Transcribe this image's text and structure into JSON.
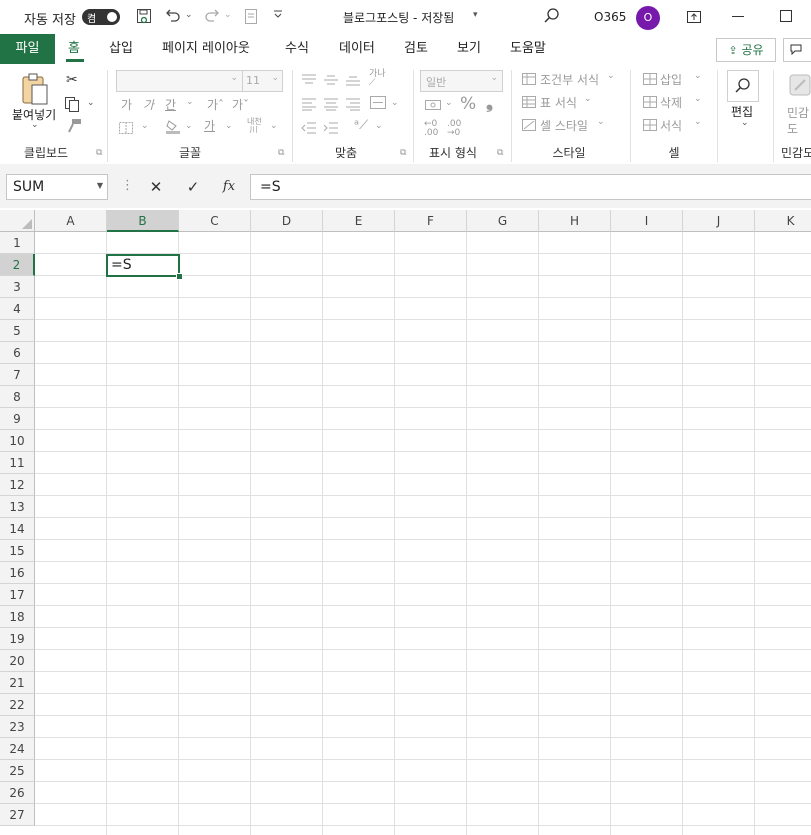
{
  "titlebar": {
    "autosave_label": "자동 저장",
    "toggle_label": "켬",
    "doc_title": "블로그포스팅 - 저장됨",
    "account_label": "O365",
    "avatar_initial": "O"
  },
  "tabs": {
    "file": "파일",
    "items": [
      "홈",
      "삽입",
      "페이지 레이아웃",
      "수식",
      "데이터",
      "검토",
      "보기",
      "도움말"
    ],
    "active": "홈",
    "share": "공유"
  },
  "ribbon": {
    "clipboard": {
      "paste": "붙여넣기",
      "label": "클립보드"
    },
    "font": {
      "size": "11",
      "label": "글꼴"
    },
    "align": {
      "label": "맞춤"
    },
    "number": {
      "format": "일반",
      "label": "표시 형식"
    },
    "styles": {
      "cond": "조건부 서식",
      "table": "표 서식",
      "cell": "셀 스타일",
      "label": "스타일"
    },
    "cells": {
      "insert": "삽입",
      "delete": "삭제",
      "format": "서식",
      "label": "셀"
    },
    "edit": {
      "label": "편집"
    },
    "sensitivity": {
      "label": "민감도",
      "partial": "민감",
      "partial2": "도"
    }
  },
  "formula_bar": {
    "name_box": "SUM",
    "fx": "fx",
    "content": "=S"
  },
  "sheet": {
    "columns": [
      "A",
      "B",
      "C",
      "D",
      "E",
      "F",
      "G",
      "H",
      "I",
      "J",
      "K"
    ],
    "rows": [
      "1",
      "2",
      "3",
      "4",
      "5",
      "6",
      "7",
      "8",
      "9",
      "10",
      "11",
      "12",
      "13",
      "14",
      "15",
      "16",
      "17",
      "18",
      "19",
      "20",
      "21",
      "22",
      "23",
      "24",
      "25",
      "26",
      "27"
    ],
    "selected_column": "B",
    "selected_row": "2",
    "active_cell_value": "=S"
  },
  "colors": {
    "accent": "#217346",
    "avatar": "#7719aa"
  }
}
